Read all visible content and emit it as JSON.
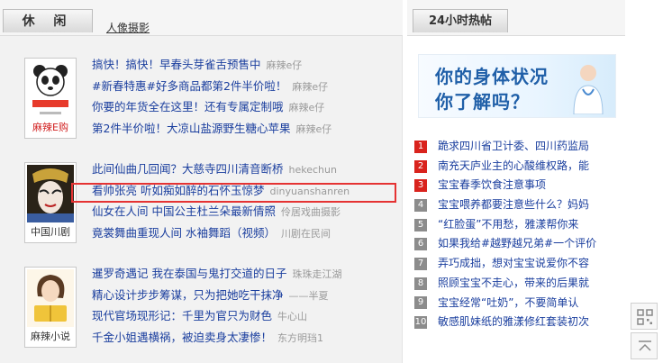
{
  "left_header": {
    "active_tab": "休 闲",
    "tab_link": "人像摄影"
  },
  "groups": [
    {
      "thumb_caption": "麻辣E购",
      "items": [
        {
          "title": "搞快！搞快！早春头芽雀舌预售中",
          "author": "麻辣e仔"
        },
        {
          "title": "#新春特惠#好多商品都第2件半价啦！",
          "author": "麻辣e仔"
        },
        {
          "title": "你要的年货全在这里！还有专属定制哦",
          "author": "麻辣e仔"
        },
        {
          "title": "第2件半价啦！大凉山盐源野生糖心苹果",
          "author": "麻辣e仔"
        }
      ]
    },
    {
      "thumb_caption": "中国川剧",
      "items": [
        {
          "title": "此间仙曲几回闻？大慈寺四川清音断桥",
          "author": "hekechun"
        },
        {
          "title": "看帅张亮 听如痴如醉的石怀玉惊梦",
          "author": "dinyuanshanren"
        },
        {
          "title": "仙女在人间 中国公主杜兰朵最新倩照",
          "author": "伶居戏曲摄影"
        },
        {
          "title": "竟裳舞曲重现人间 水袖舞蹈（视频）",
          "author": "川剧在民间"
        }
      ]
    },
    {
      "thumb_caption": "麻辣小说",
      "items": [
        {
          "title": "暹罗奇遇记 我在泰国与鬼打交道的日子",
          "author": "珠珠走江湖"
        },
        {
          "title": "精心设计步步筹谋，只为把她吃干抹净",
          "author": "——半夏"
        },
        {
          "title": "现代官场现形记：千里为官只为财色",
          "author": "牛心山"
        },
        {
          "title": "千金小姐遇横祸，被迫卖身太凄惨！",
          "author": "东方明珰1"
        }
      ]
    }
  ],
  "right_header": {
    "tab": "24小时热帖"
  },
  "banner": {
    "line1": "你的身体状况",
    "line2": "你了解吗？"
  },
  "hot_list": [
    {
      "rank": "1",
      "title": "跪求四川省卫计委、四川药监局"
    },
    {
      "rank": "2",
      "title": "南充天庐业主的心酸维权路，能"
    },
    {
      "rank": "3",
      "title": "宝宝春季饮食注意事项"
    },
    {
      "rank": "4",
      "title": "宝宝喂养都要注意些什么？妈妈"
    },
    {
      "rank": "5",
      "title": "“红脸蛋”不用愁，雅漾帮你来"
    },
    {
      "rank": "6",
      "title": "如果我给#越野越兄弟#一个评价"
    },
    {
      "rank": "7",
      "title": "弄巧成拙，想对宝宝说爱你不容"
    },
    {
      "rank": "8",
      "title": "照顾宝宝不走心，带来的后果就"
    },
    {
      "rank": "9",
      "title": "宝宝经常“吐奶”，不要简单认"
    },
    {
      "rank": "10",
      "title": "敏感肌妹纸的雅漾修红套装初次"
    }
  ],
  "colors": {
    "link": "#1a3e9e",
    "meta": "#999999",
    "rank_top": "#d9231d",
    "rank_rest": "#8c8c8c",
    "highlight_border": "#e53333"
  }
}
